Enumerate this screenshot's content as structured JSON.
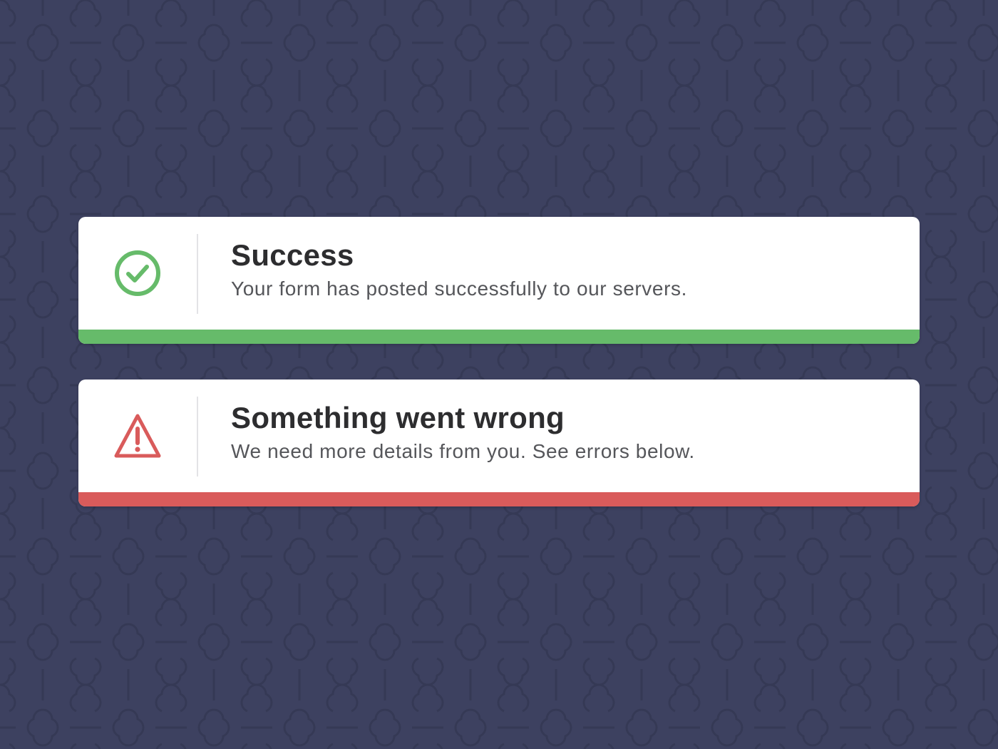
{
  "colors": {
    "background": "#3d4160",
    "pattern": "#353955",
    "success": "#66bb6a",
    "error": "#d95b5b",
    "card": "#ffffff"
  },
  "alerts": [
    {
      "type": "success",
      "icon": "check-circle-icon",
      "title": "Success",
      "message": "Your form has posted successfully to our servers."
    },
    {
      "type": "error",
      "icon": "warning-triangle-icon",
      "title": "Something went wrong",
      "message": "We need more details from you. See errors below."
    }
  ]
}
